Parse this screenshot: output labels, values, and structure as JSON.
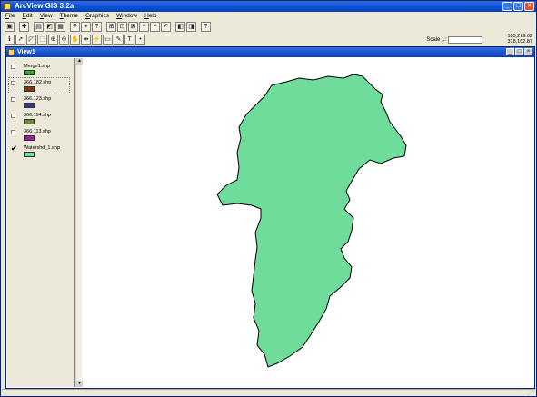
{
  "app": {
    "title": "ArcView GIS 3.2a",
    "window_buttons": {
      "minimize": "_",
      "maximize": "□",
      "close": "×"
    }
  },
  "menu": [
    "File",
    "Edit",
    "View",
    "Theme",
    "Graphics",
    "Window",
    "Help"
  ],
  "toolbar": {
    "scale_label": "Scale 1:",
    "scale_value": "",
    "coord_x": "105,279.62",
    "coord_y": "318,162.87"
  },
  "view": {
    "title": "View1",
    "window_buttons": {
      "minimize": "_",
      "maximize": "□",
      "close": "×"
    }
  },
  "themes": [
    {
      "name": "Merge1.shp",
      "visible": false,
      "color": "#2fae2f",
      "active": false
    },
    {
      "name": "366.182.shp",
      "visible": false,
      "color": "#7a3a1a",
      "active": true
    },
    {
      "name": "366.123.shp",
      "visible": false,
      "color": "#3a3a8c",
      "active": false
    },
    {
      "name": "366.114.shp",
      "visible": false,
      "color": "#6b8a2e",
      "active": false
    },
    {
      "name": "366.113.shp",
      "visible": false,
      "color": "#9a1fa6",
      "active": false
    },
    {
      "name": "Watershd_1.shp",
      "visible": true,
      "color": "#6fdc9c",
      "active": false
    }
  ],
  "map": {
    "fill_color": "#6fdc9c",
    "outline_color": "#000000"
  }
}
